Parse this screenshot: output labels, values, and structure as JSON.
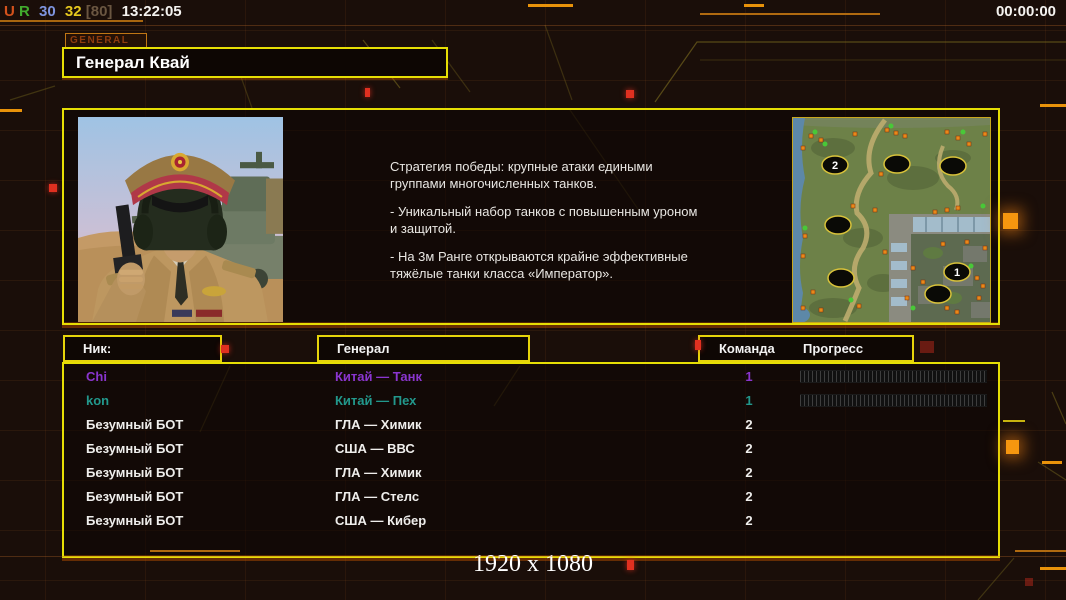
{
  "topbar": {
    "segments": [
      {
        "text": "U",
        "color": "#d4521c"
      },
      {
        "text": "R",
        "color": "#41ab2d"
      },
      {
        "text": "30",
        "color": "#7e94de"
      },
      {
        "text": "32",
        "color": "#e6c81e"
      },
      {
        "text": "[80]",
        "color": "#6a5641"
      },
      {
        "text": "13:22:05",
        "color": "#f5f3f0"
      }
    ],
    "timer": "00:00:00"
  },
  "header": {
    "tab": "GENERAL",
    "title": "Генерал Квай"
  },
  "strategy": {
    "paragraphs": [
      "Стратегия победы: крупные атаки едиными\n группами многочисленных танков.",
      "- Уникальный набор танков с повышенным уроном\n и защитой.",
      "- На 3м Ранге открываются крайне эффективные\n тяжёлые танки класса «Император»."
    ]
  },
  "minimap": {
    "start_labels": [
      "2",
      "1"
    ]
  },
  "table": {
    "headers": {
      "nick": "Ник:",
      "general": "Генерал",
      "team": "Команда",
      "progress": "Прогресс"
    },
    "rows": [
      {
        "name": "Chi",
        "general": "Китай — Танк",
        "team": "1",
        "color": "#8a35cf"
      },
      {
        "name": "kon",
        "general": "Китай — Пех",
        "team": "1",
        "color": "#22988c"
      },
      {
        "name": "Безумный БОТ",
        "general": "ГЛА — Химик",
        "team": "2",
        "color": "#efeeec"
      },
      {
        "name": "Безумный БОТ",
        "general": "США — ВВС",
        "team": "2",
        "color": "#efeeec"
      },
      {
        "name": "Безумный БОТ",
        "general": "ГЛА — Химик",
        "team": "2",
        "color": "#efeeec"
      },
      {
        "name": "Безумный БОТ",
        "general": "ГЛА — Стелс",
        "team": "2",
        "color": "#efeeec"
      },
      {
        "name": "Безумный БОТ",
        "general": "США — Кибер",
        "team": "2",
        "color": "#efeeec"
      }
    ]
  },
  "footer": {
    "resolution": "1920 x 1080"
  },
  "colors": {
    "panel_border": "#e6de04",
    "accent_orange": "#e8920a",
    "decor_red": "#e03020"
  }
}
